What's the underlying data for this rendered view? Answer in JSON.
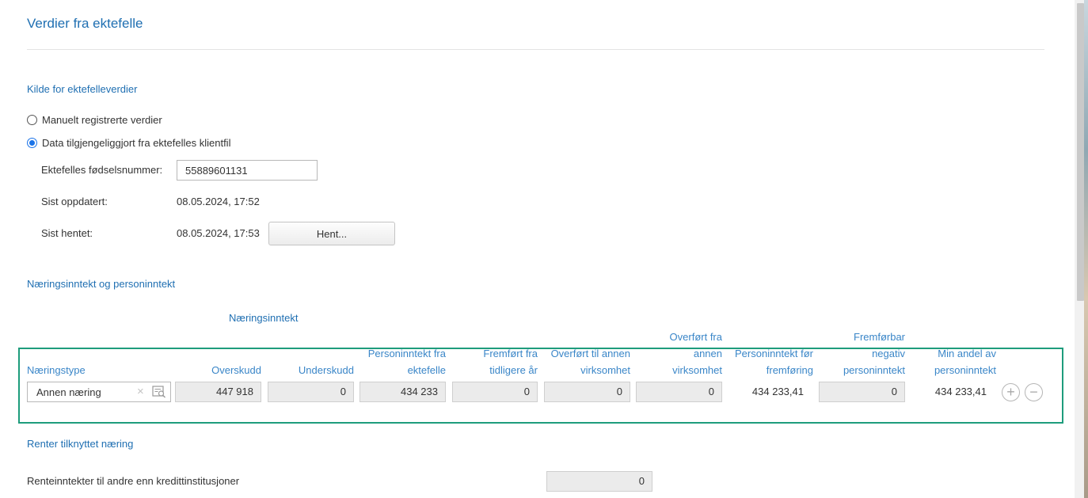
{
  "page": {
    "title": "Verdier fra ektefelle"
  },
  "source_section": {
    "heading": "Kilde for ektefelleverdier",
    "options": [
      {
        "label": "Manuelt registrerte verdier",
        "selected": false
      },
      {
        "label": "Data tilgjengeliggjort fra ektefelles klientfil",
        "selected": true
      }
    ],
    "birth_number_label": "Ektefelles fødselsnummer:",
    "birth_number_value": "55889601131",
    "last_updated_label": "Sist oppdatert:",
    "last_updated_value": "08.05.2024, 17:52",
    "last_fetched_label": "Sist hentet:",
    "last_fetched_value": "08.05.2024, 17:53",
    "fetch_button": "Hent..."
  },
  "income_section": {
    "heading": "Næringsinntekt og personinntekt",
    "group_header": "Næringsinntekt",
    "columns": {
      "type": "Næringstype",
      "surplus": "Overskudd",
      "deficit": "Underskudd",
      "personal_income_from_spouse_1": "Personinntekt fra",
      "personal_income_from_spouse_2": "ektefelle",
      "carried_forward_1": "Fremført fra",
      "carried_forward_2": "tidligere år",
      "transferred_to_1": "Overført til annen",
      "transferred_to_2": "virksomhet",
      "transferred_from_1": "Overført fra",
      "transferred_from_2": "annen",
      "transferred_from_3": "virksomhet",
      "personal_income_before_1": "Personinntekt før",
      "personal_income_before_2": "fremføring",
      "negative_carry_1": "Fremførbar",
      "negative_carry_2": "negativ",
      "negative_carry_3": "personinntekt",
      "min_share_1": "Min andel av",
      "min_share_2": "personinntekt"
    },
    "row": {
      "type": "Annen næring",
      "surplus": "447 918",
      "deficit": "0",
      "personal_income_from_spouse": "434 233",
      "carried_forward": "0",
      "transferred_to": "0",
      "transferred_from": "0",
      "personal_income_before": "434 233,41",
      "negative_carry": "0",
      "min_share": "434 233,41"
    },
    "add_symbol": "+",
    "remove_symbol": "−",
    "clear_symbol": "×",
    "accent_color": "#1e9c7c"
  },
  "interest_section": {
    "heading": "Renter tilknyttet næring",
    "row_label": "Renteinntekter til andre enn kredittinstitusjoner",
    "row_value": "0"
  }
}
